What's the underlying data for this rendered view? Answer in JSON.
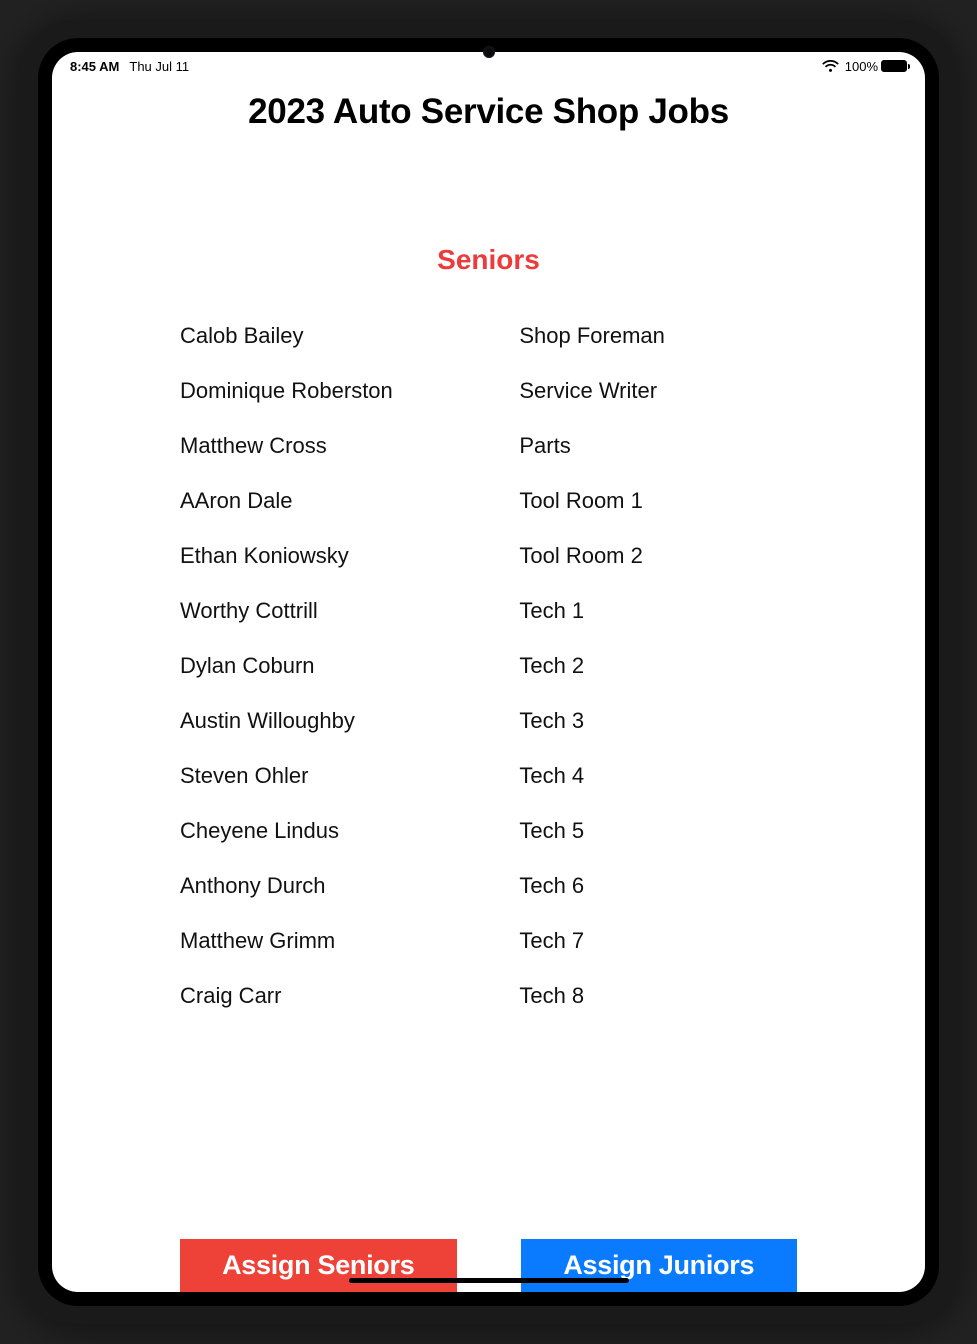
{
  "status": {
    "time": "8:45 AM",
    "date": "Thu Jul 11",
    "battery_pct": "100%"
  },
  "page_title": "2023 Auto Service Shop Jobs",
  "section_title": "Seniors",
  "rows": [
    {
      "name": "Calob Bailey",
      "job": "Shop Foreman"
    },
    {
      "name": "Dominique Roberston",
      "job": "Service Writer"
    },
    {
      "name": "Matthew Cross",
      "job": "Parts"
    },
    {
      "name": "AAron Dale",
      "job": "Tool Room 1"
    },
    {
      "name": "Ethan Koniowsky",
      "job": "Tool Room 2"
    },
    {
      "name": "Worthy Cottrill",
      "job": "Tech 1"
    },
    {
      "name": "Dylan Coburn",
      "job": "Tech 2"
    },
    {
      "name": "Austin Willoughby",
      "job": "Tech 3"
    },
    {
      "name": "Steven Ohler",
      "job": "Tech 4"
    },
    {
      "name": "Cheyene Lindus",
      "job": "Tech 5"
    },
    {
      "name": "Anthony Durch",
      "job": "Tech 6"
    },
    {
      "name": "Matthew Grimm",
      "job": "Tech 7"
    },
    {
      "name": "Craig Carr",
      "job": "Tech 8"
    }
  ],
  "buttons": {
    "assign_seniors": "Assign Seniors",
    "assign_juniors": "Assign Juniors"
  }
}
